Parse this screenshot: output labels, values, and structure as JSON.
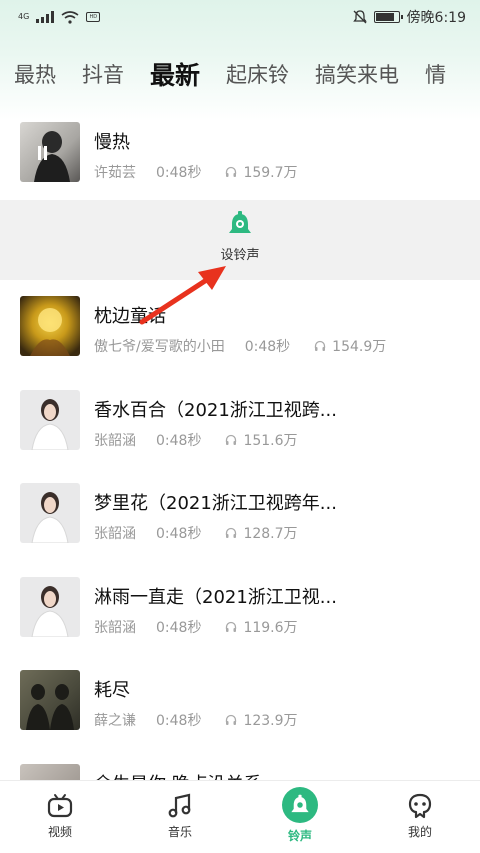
{
  "status_bar": {
    "network": "4G",
    "carrier_badge": "HD",
    "time": "傍晚6:19",
    "icons": [
      "signal-icon",
      "wifi-icon",
      "mute-icon",
      "battery-icon"
    ]
  },
  "tabs": [
    {
      "label": "最热",
      "active": false
    },
    {
      "label": "抖音",
      "active": false
    },
    {
      "label": "最新",
      "active": true
    },
    {
      "label": "起床铃",
      "active": false
    },
    {
      "label": "搞笑来电",
      "active": false
    },
    {
      "label": "情",
      "active": false
    }
  ],
  "songs": [
    {
      "title": "慢热",
      "artist": "许茹芸",
      "duration": "0:48秒",
      "plays": "159.7万",
      "playing": true
    },
    {
      "title": "枕边童话",
      "artist": "傲七爷/爱写歌的小田",
      "duration": "0:48秒",
      "plays": "154.9万"
    },
    {
      "title": "香水百合（2021浙江卫视跨...",
      "artist": "张韶涵",
      "duration": "0:48秒",
      "plays": "151.6万"
    },
    {
      "title": "梦里花（2021浙江卫视跨年...",
      "artist": "张韶涵",
      "duration": "0:48秒",
      "plays": "128.7万"
    },
    {
      "title": "淋雨一直走（2021浙江卫视...",
      "artist": "张韶涵",
      "duration": "0:48秒",
      "plays": "119.6万"
    },
    {
      "title": "耗尽",
      "artist": "薛之谦",
      "duration": "0:48秒",
      "plays": "123.9万"
    },
    {
      "title": "余生是你 晚点没关系",
      "artist": "",
      "duration": "",
      "plays": ""
    }
  ],
  "action_panel": {
    "set_ringtone_label": "设铃声"
  },
  "bottom_nav": [
    {
      "label": "视频",
      "icon": "tv-icon",
      "active": false
    },
    {
      "label": "音乐",
      "icon": "music-note-icon",
      "active": false
    },
    {
      "label": "铃声",
      "icon": "bell-icon",
      "active": true
    },
    {
      "label": "我的",
      "icon": "profile-icon",
      "active": false
    }
  ],
  "colors": {
    "accent": "#2db981",
    "annotation_arrow": "#e8321e"
  }
}
